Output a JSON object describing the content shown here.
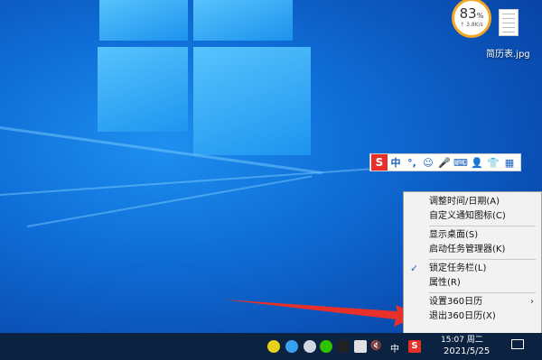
{
  "desktop": {
    "net_widget": {
      "percent": "83",
      "percent_sign": "%",
      "speed": "↑ 3.8K/s"
    },
    "file_icon": {
      "label": "简历表.jpg"
    }
  },
  "ime_toolbar": {
    "logo": "S",
    "items": [
      "中",
      "°,",
      "☺",
      "🎤",
      "⌨",
      "👤",
      "👕",
      "▦"
    ]
  },
  "context_menu": {
    "items": [
      {
        "label": "调整时间/日期(A)"
      },
      {
        "label": "自定义通知图标(C)"
      },
      {
        "label": "显示桌面(S)"
      },
      {
        "label": "启动任务管理器(K)"
      },
      {
        "label": "锁定任务栏(L)",
        "checked": true
      },
      {
        "label": "属性(R)"
      },
      {
        "label": "设置360日历",
        "submenu": true
      },
      {
        "label": "退出360日历(X)"
      }
    ],
    "check_mark": "✓",
    "submenu_arrow": "›"
  },
  "taskbar": {
    "tray": {
      "lang": "中",
      "volume": "🔇",
      "ime_logo": "S"
    },
    "clock_time": "15:07 周二",
    "clock_date": "2021/5/25"
  },
  "colors": {
    "arrow": "#e8302a",
    "accent": "#1e64c8"
  }
}
